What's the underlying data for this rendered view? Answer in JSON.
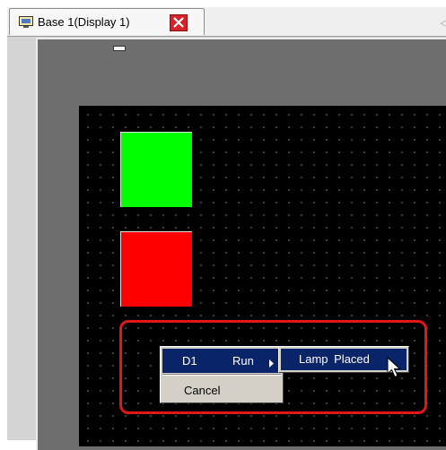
{
  "tab": {
    "title": "Base 1(Display 1)",
    "icon": "screen-icon",
    "close_icon": "close-icon"
  },
  "context_menu": {
    "items": [
      {
        "label": "D1",
        "sublabel": "Run",
        "has_submenu": true,
        "selected": true
      },
      {
        "label": "Cancel",
        "has_submenu": false,
        "selected": false
      }
    ]
  },
  "submenu": {
    "items": [
      {
        "label": "Lamp Placed",
        "selected": true
      }
    ]
  },
  "colors": {
    "lamp_on": "#00ff00",
    "lamp_off": "#ff0000",
    "menu_highlight": "#0a246a",
    "callout": "#e01818"
  }
}
